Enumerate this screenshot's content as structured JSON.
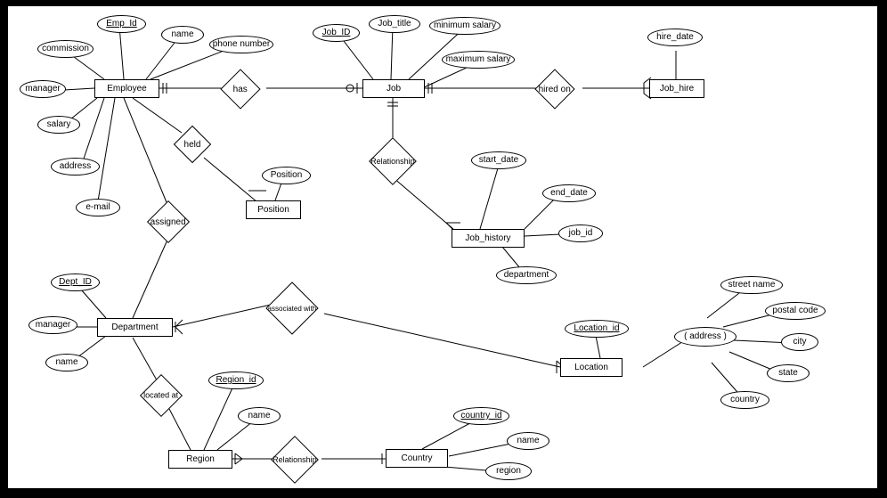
{
  "entities": {
    "employee": "Employee",
    "job": "Job",
    "job_hire": "Job_hire",
    "position": "Position",
    "job_history": "Job_history",
    "department": "Department",
    "location": "Location",
    "region": "Region",
    "country": "Country"
  },
  "relationships": {
    "has": "has",
    "held": "held",
    "hired_on": "hired on",
    "rel_job_hist": "Relationship",
    "assigned": "assigned",
    "associated_with": "associated with",
    "located_at": "located at",
    "rel_region_country": "Relationship"
  },
  "attributes": {
    "emp_id": "Emp_Id",
    "emp_name": "name",
    "phone_number": "phone number",
    "commission": "commission",
    "manager_emp": "manager",
    "salary": "salary",
    "address_emp": "address",
    "email": "e-mail",
    "job_id": "Job_ID",
    "job_title": "Job_title",
    "min_salary": "minimum salary",
    "max_salary": "maximum salary",
    "hire_date": "hire_date",
    "position_attr": "Position",
    "start_date": "start_date",
    "end_date": "end_date",
    "jh_job_id": "job_id",
    "jh_department": "department",
    "dept_id": "Dept_ID",
    "manager_dept": "manager",
    "dept_name": "name",
    "location_id": "Location_id",
    "loc_address": "( address )",
    "street_name": "street name",
    "postal_code": "postal code",
    "city": "city",
    "state": "state",
    "loc_country": "country",
    "region_id": "Region_id",
    "region_name": "name",
    "country_id": "country_id",
    "country_name": "name",
    "country_region": "region"
  }
}
